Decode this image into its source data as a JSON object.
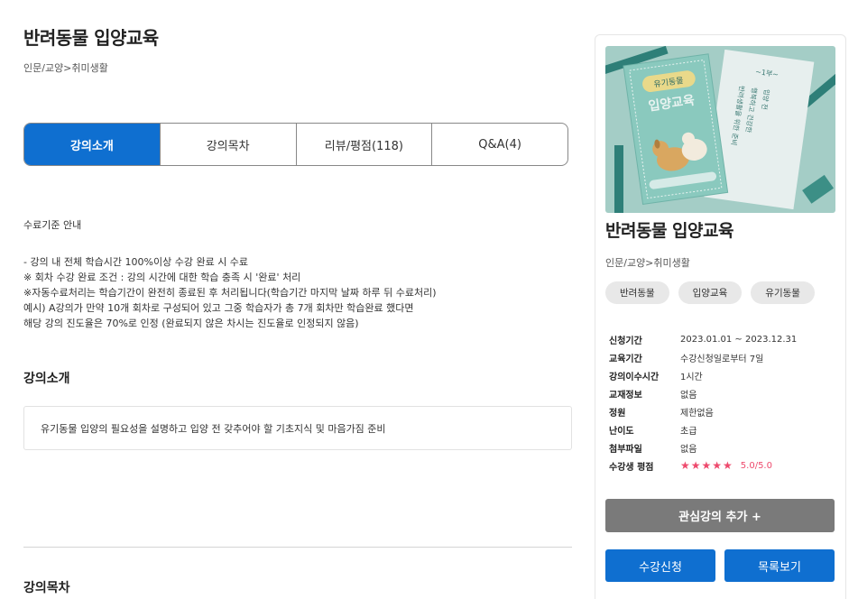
{
  "course": {
    "title": "반려동물 입양교육",
    "breadcrumb": "인문/교양>취미생활"
  },
  "tabs": [
    {
      "label": "강의소개",
      "active": true
    },
    {
      "label": "강의목차",
      "active": false
    },
    {
      "label": "리뷰/평점(118)",
      "active": false
    },
    {
      "label": "Q&A(4)",
      "active": false
    }
  ],
  "completion": {
    "title": "수료기준 안내",
    "lines": [
      "- 강의 내 전체 학습시간 100%이상 수강 완료 시 수료",
      "※ 회차 수강 완료 조건 : 강의 시간에 대한 학습 충족 시 '완료' 처리",
      "※자동수료처리는 학습기간이 완전히 종료된 후 처리됩니다(학습기간 마지막 날짜 하루 뒤 수료처리)",
      "예시) A강의가 만약 10개 회차로 구성되어 있고 그중 학습자가 총 7개 회차만 학습완료 했다면",
      "해당 강의 진도율은 70%로 인정 (완료되지 않은 차시는 진도율로 인정되지 않음)"
    ]
  },
  "intro": {
    "heading": "강의소개",
    "text": "유기동물 입양의 필요성을 설명하고 입양 전 갖추어야 할 기초지식 및 마음가짐 준비"
  },
  "toc": {
    "heading": "강의목차"
  },
  "sidebar": {
    "title": "반려동물 입양교육",
    "breadcrumb": "인문/교양>취미생활",
    "thumbnail": {
      "book_badge": "유기동물",
      "book_title": "입양교육",
      "note_header": "~1부~",
      "note_lines": [
        "입양 전",
        "행복하고 건강한",
        "반려생활을 위한 준비"
      ],
      "colors": {
        "background": "#a4cdc6",
        "book": "#8ac9be",
        "pen": "#2e7f78"
      }
    },
    "tags": [
      "반려동물",
      "입양교육",
      "유기동물"
    ],
    "info": [
      {
        "key": "신청기간",
        "value": "2023.01.01 ~ 2023.12.31"
      },
      {
        "key": "교육기간",
        "value": "수강신청일로부터 7일"
      },
      {
        "key": "강의이수시간",
        "value": "1시간"
      },
      {
        "key": "교재정보",
        "value": "없음"
      },
      {
        "key": "정원",
        "value": "제한없음"
      },
      {
        "key": "난이도",
        "value": "초급"
      },
      {
        "key": "첨부파일",
        "value": "없음"
      }
    ],
    "rating": {
      "key": "수강생 평점",
      "stars": "★★★★★",
      "score": "5.0/5.0",
      "value": 5
    },
    "buttons": {
      "wishlist": "관심강의 추가 +",
      "enroll": "수강신청",
      "list": "목록보기"
    }
  },
  "colors": {
    "primary": "#0f6fd0",
    "wishlist_button": "#7a7a7a",
    "star": "#ee4a6d"
  }
}
